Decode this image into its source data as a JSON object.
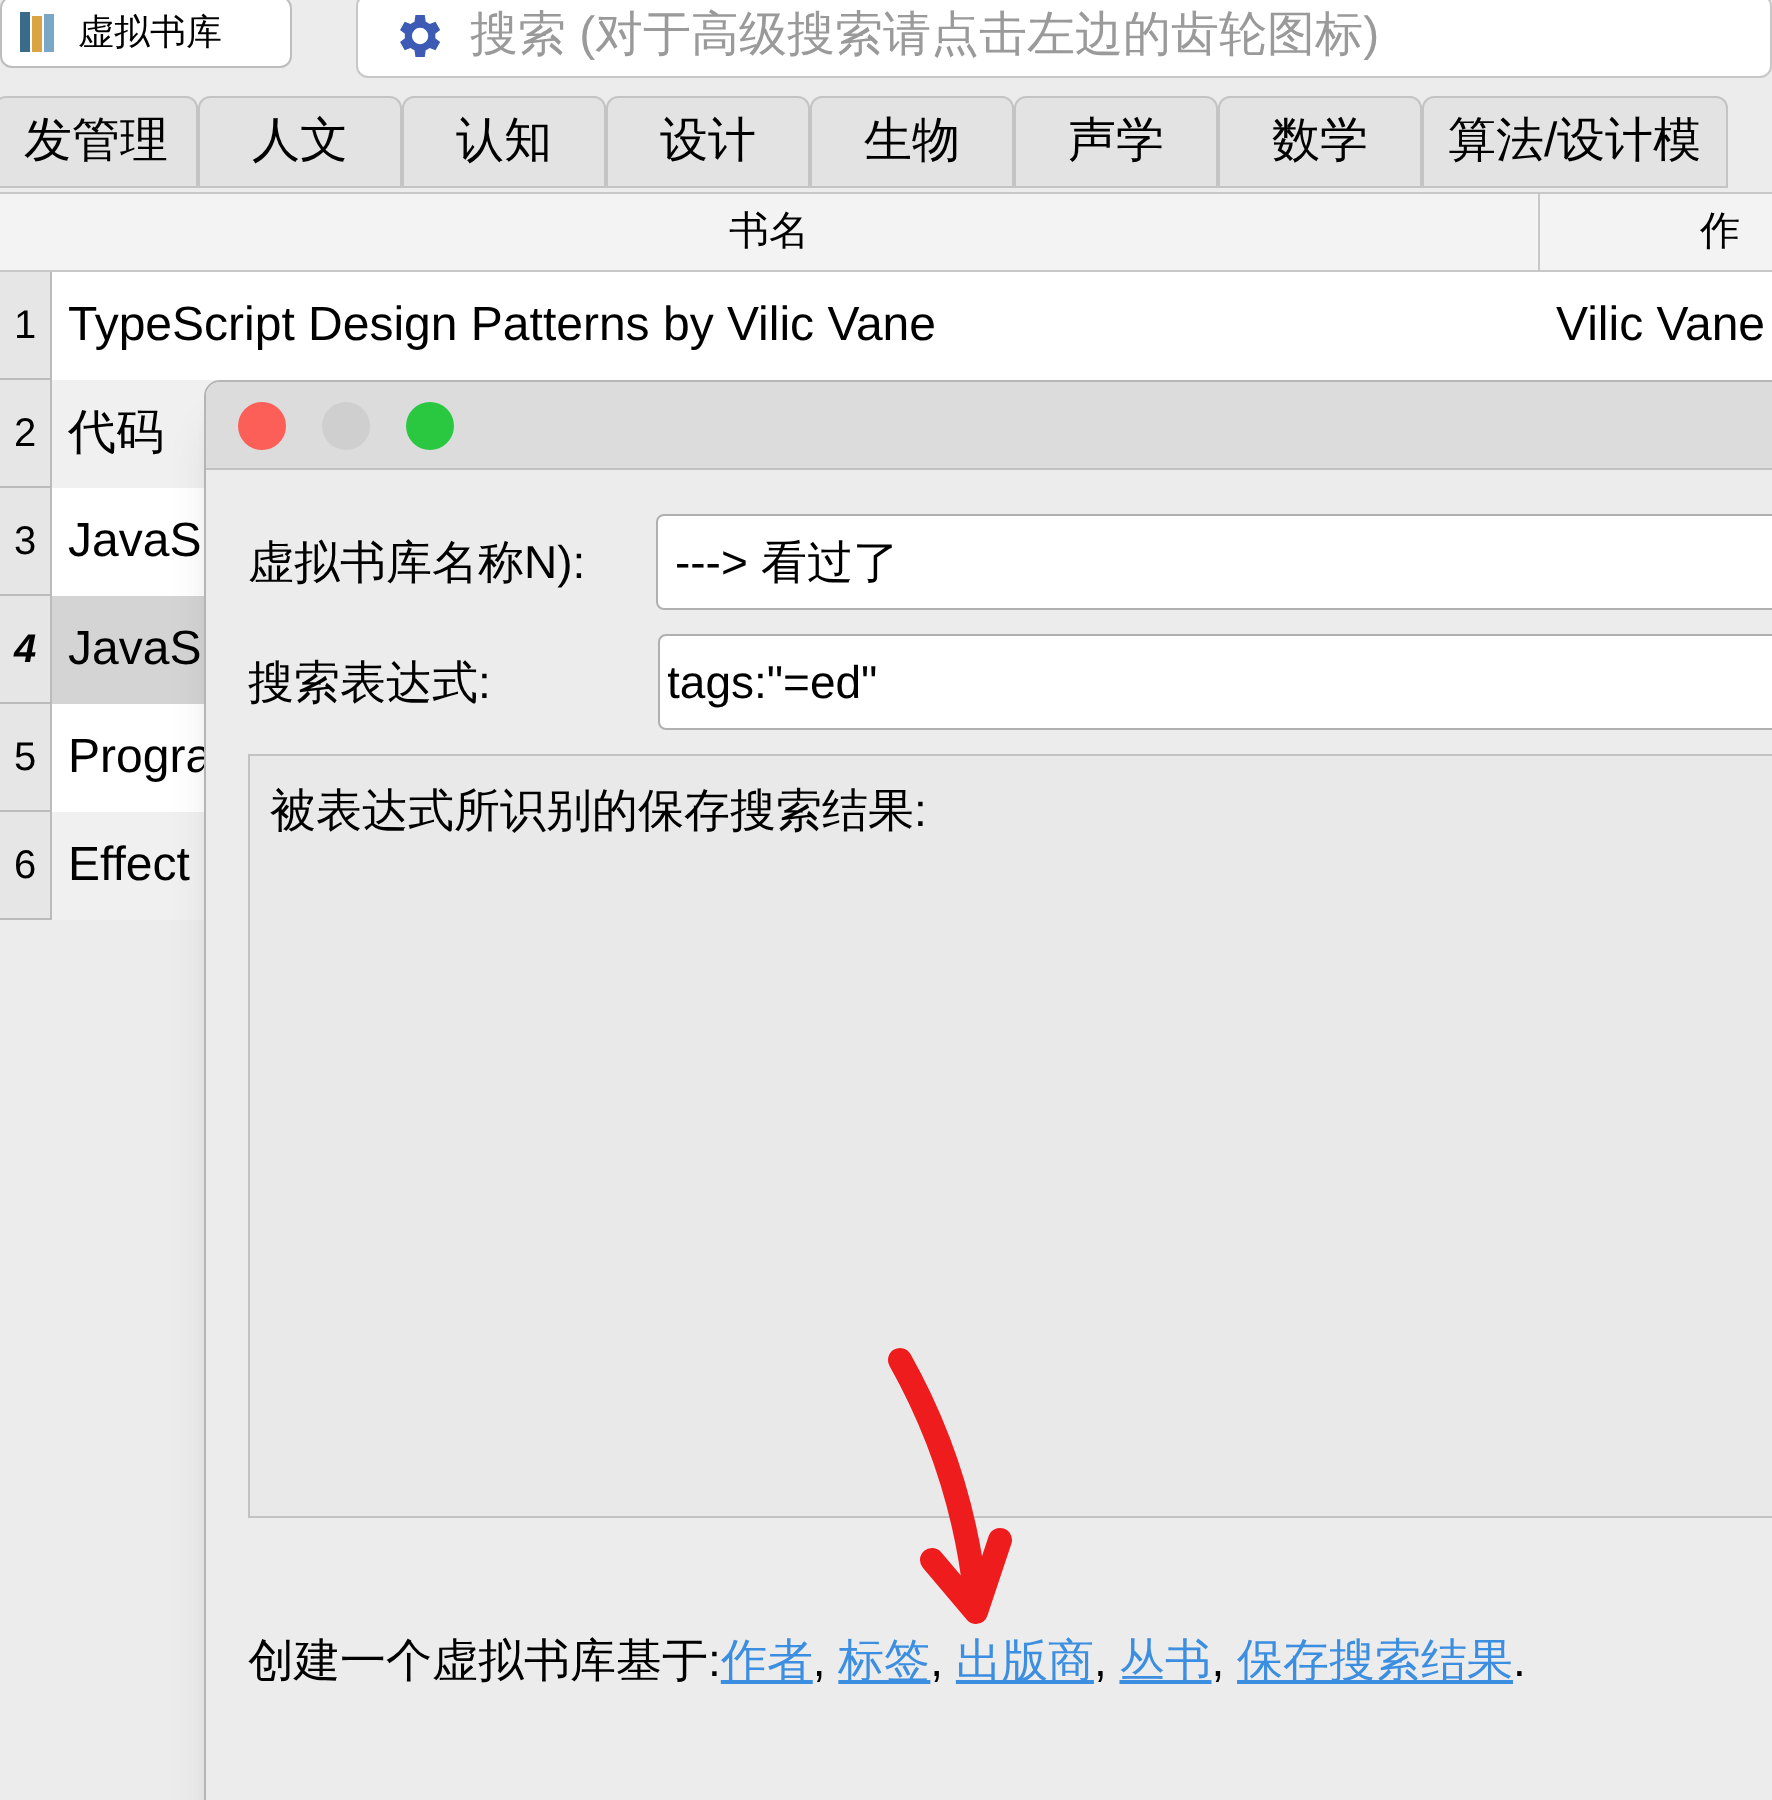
{
  "toolbar": {
    "library_button": "虚拟书库",
    "search": {
      "placeholder": "搜索 (对于高级搜索请点击左边的齿轮图标)"
    }
  },
  "tabs": [
    "发管理",
    "人文",
    "认知",
    "设计",
    "生物",
    "声学",
    "数学",
    "算法/设计模"
  ],
  "table": {
    "columns": [
      "书名",
      "作"
    ],
    "rows": [
      {
        "number": "1",
        "title": "TypeScript Design Patterns by Vilic Vane",
        "author": "Vilic Vane",
        "selected": false
      },
      {
        "number": "2",
        "title": "代码",
        "selected": false
      },
      {
        "number": "3",
        "title": "JavaS",
        "selected": false
      },
      {
        "number": "4",
        "title": "JavaS",
        "selected": true
      },
      {
        "number": "5",
        "title": "Progra",
        "selected": false
      },
      {
        "number": "6",
        "title": "Effect",
        "selected": false
      }
    ]
  },
  "dialog": {
    "name_label": "虚拟书库名称N):",
    "name_value": "---> 看过了",
    "expression_label": "搜索表达式:",
    "expression_value": "tags:\"=ed\"",
    "results_label": "被表达式所识别的保存搜索结果:",
    "create_text": "创建一个虚拟书库基于:",
    "links": [
      {
        "label": "作者",
        "after": ","
      },
      {
        "label": "标签",
        "after": ","
      },
      {
        "label": "出版商",
        "after": ","
      },
      {
        "label": "丛书",
        "after": ","
      },
      {
        "label": "保存搜索结果",
        "after": "."
      }
    ]
  }
}
